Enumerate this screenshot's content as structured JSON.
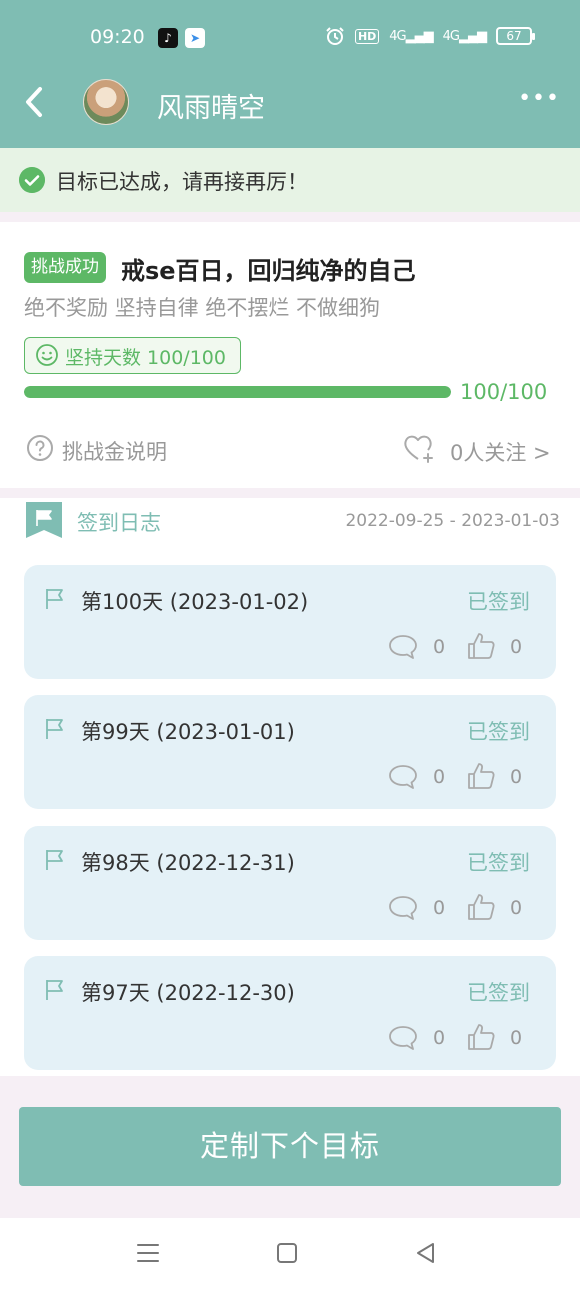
{
  "status_bar": {
    "time": "09:20",
    "icons": [
      "tiktok-icon",
      "message-plane-icon",
      "alarm-icon",
      "hd-icon",
      "signal-4g-icon",
      "signal-4g-icon"
    ],
    "hd_label": "HD",
    "network_1": "4G",
    "network_2": "4G",
    "battery": "67"
  },
  "header": {
    "back_icon": "chevron-left-icon",
    "name": "风雨晴空",
    "more_icon": "more-dots-icon",
    "more_label": "•••"
  },
  "notice": {
    "icon": "check-circle-icon",
    "text": "目标已达成，请再接再厉！"
  },
  "challenge": {
    "tag": "挑战成功",
    "title": "戒se百日，回归纯净的自己",
    "subtitle": "绝不奖励 坚持自律 绝不摆烂 不做细狗",
    "days_label": "坚持天数 100/100",
    "progress": 1.0,
    "progress_label": "100/100",
    "help_label": "挑战金说明",
    "follow_label": "0人关注 >"
  },
  "log": {
    "title": "签到日志",
    "date_range": "2022-09-25 - 2023-01-03",
    "entries": [
      {
        "title": "第100天 (2023-01-02)",
        "status": "已签到",
        "comments": "0",
        "likes": "0"
      },
      {
        "title": "第99天 (2023-01-01)",
        "status": "已签到",
        "comments": "0",
        "likes": "0"
      },
      {
        "title": "第98天 (2022-12-31)",
        "status": "已签到",
        "comments": "0",
        "likes": "0"
      },
      {
        "title": "第97天 (2022-12-30)",
        "status": "已签到",
        "comments": "0",
        "likes": "0"
      }
    ]
  },
  "cta": {
    "label": "定制下个目标"
  },
  "system_nav": [
    "menu-icon",
    "home-square-icon",
    "back-triangle-icon"
  ],
  "colors": {
    "teal": "#7fbdb3",
    "green": "#5db866",
    "entry_bg": "#e4f1f7"
  }
}
